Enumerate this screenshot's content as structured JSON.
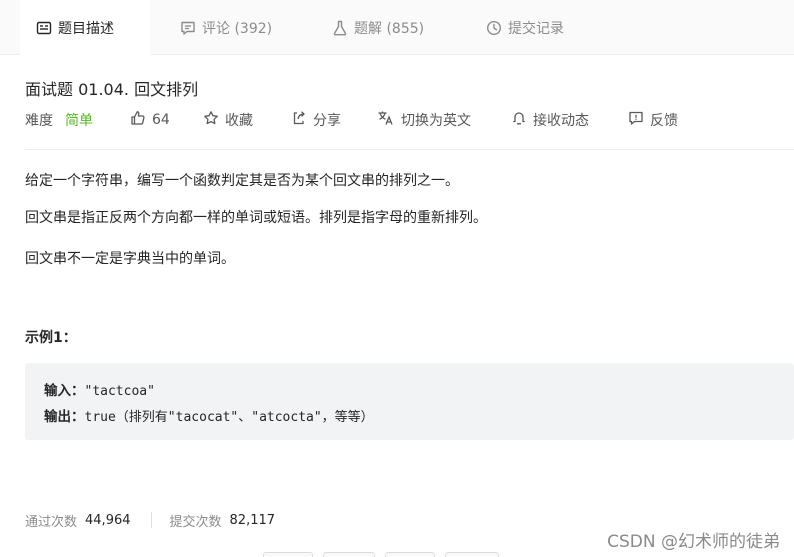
{
  "tabs": [
    {
      "label": "题目描述",
      "icon": "description-icon",
      "active": true
    },
    {
      "label": "评论 (392)",
      "icon": "comment-icon",
      "active": false
    },
    {
      "label": "题解 (855)",
      "icon": "flask-icon",
      "active": false
    },
    {
      "label": "提交记录",
      "icon": "clock-icon",
      "active": false
    }
  ],
  "problem": {
    "title": "面试题 01.04. 回文排列",
    "difficulty_label": "难度",
    "difficulty_value": "简单",
    "difficulty_color": "#5ab726"
  },
  "actions": {
    "likes": "64",
    "favorite": "收藏",
    "share": "分享",
    "switch_lang": "切换为英文",
    "subscribe": "接收动态",
    "feedback": "反馈"
  },
  "description": {
    "p1": "给定一个字符串，编写一个函数判定其是否为某个回文串的排列之一。",
    "p2": "回文串是指正反两个方向都一样的单词或短语。排列是指字母的重新排列。",
    "p3": "回文串不一定是字典当中的单词。"
  },
  "example": {
    "heading": "示例1：",
    "input_label": "输入：",
    "input_value": "\"tactcoa\"",
    "output_label": "输出：",
    "output_value": "true（排列有\"tacocat\"、\"atcocta\"，等等）"
  },
  "stats": {
    "passed_label": "通过次数",
    "passed_value": "44,964",
    "submitted_label": "提交次数",
    "submitted_value": "82,117"
  },
  "watermark": "CSDN @幻术师的徒弟"
}
